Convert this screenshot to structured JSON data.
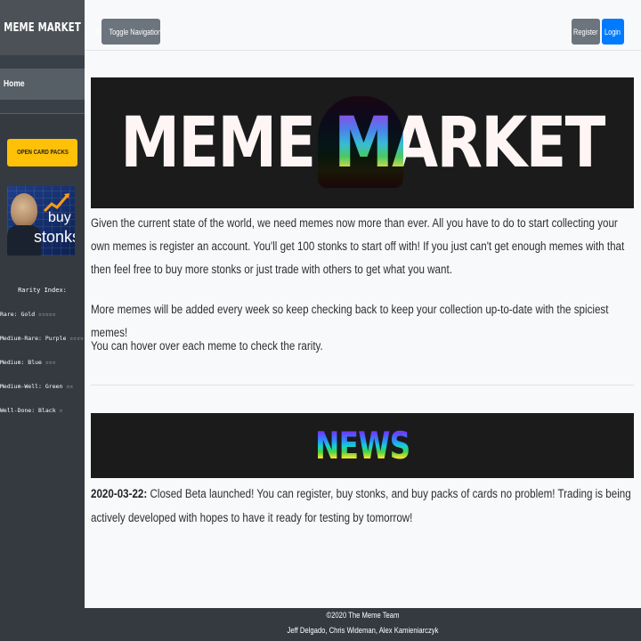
{
  "sidebar": {
    "brand": "MEME MARKET",
    "items": [
      {
        "label": "Home"
      }
    ],
    "open_packs_label": "OPEN CARD PACKS",
    "stonks_image": {
      "line1": "buy",
      "line2": "stonks"
    },
    "rarity": {
      "title": "Rarity Index:",
      "levels": [
        "Rare: Gold ☆☆☆☆☆",
        "Medium-Rare: Purple ☆☆☆☆",
        "Medium: Blue ☆☆☆",
        "Medium-Well: Green ☆☆",
        "Well-Done: Black ☆"
      ]
    }
  },
  "header": {
    "toggle_label": "Toggle Navigation",
    "register_label": "Register",
    "login_label": "Login"
  },
  "main": {
    "banner_title": "MEME MARKET",
    "paragraphs": [
      "Given the current state of the world, we need memes now more than ever. All you have to do to start collecting your own memes is register an account. You'll get 100 stonks to start off with! If you just can't get enough memes with that then feel free to buy more stonks or just trade with others to get what you want.",
      "More memes will be added every week so keep checking back to keep your collection up-to-date with the spiciest memes!",
      "You can hover over each meme to check the rarity."
    ],
    "news_title": "NEWS",
    "news": {
      "date": "2020-03-22:",
      "text": " Closed Beta launched! You can register, buy stonks, and buy packs of cards no problem! Trading is being actively developed with hopes to have it ready for testing by tomorrow!"
    }
  },
  "footer": {
    "copyright": "©2020 The Meme Team",
    "authors": "Jeff Delgado, Chris Wideman, Alex Kamieniarczyk"
  },
  "colors": {
    "sidebar_bg": "#343a40",
    "warning": "#ffc107",
    "primary": "#007bff",
    "secondary": "#6c757d"
  }
}
